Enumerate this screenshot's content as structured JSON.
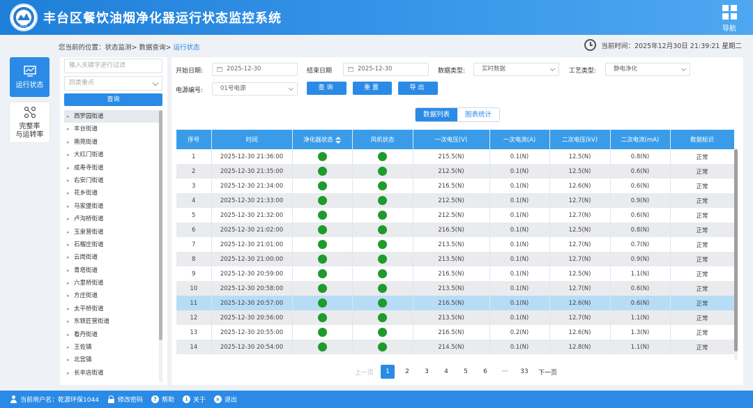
{
  "header": {
    "title": "丰台区餐饮油烟净化器运行状态监控系统",
    "logo_text": "MEE",
    "nav_label": "导航"
  },
  "breadcrumb": {
    "prefix": "您当前的位置：",
    "level1": "状态监测",
    "level2": "数据查询",
    "current": "运行状态"
  },
  "time": {
    "label": "当前时间：",
    "value": "2025年12月30日 21:39:21 星期二"
  },
  "side_nav": [
    {
      "label": "运行状态",
      "active": true
    },
    {
      "label1": "完整率",
      "label2": "与运转率",
      "active": false
    }
  ],
  "tree_panel": {
    "filter_placeholder": "输入关键字进行过滤",
    "select_placeholder": "四类重点",
    "query_label": "查询",
    "items": [
      "西罗园街道",
      "丰台街道",
      "南苑街道",
      "大红门街道",
      "成寿寺街道",
      "右安门街道",
      "花乡街道",
      "马家堡街道",
      "卢沟桥街道",
      "玉泉营街道",
      "石榴庄街道",
      "云岗街道",
      "青塔街道",
      "六里桥街道",
      "方庄街道",
      "太平桥街道",
      "东铁匠营街道",
      "看丹街道",
      "王佐镇",
      "北宫镇",
      "长辛店街道"
    ]
  },
  "filters": {
    "start_label": "开始日期:",
    "start_value": "2025-12-30",
    "end_label": "结束日期",
    "end_value": "2025-12-30",
    "data_type_label": "数据类型:",
    "data_type_value": "实时数据",
    "process_label": "工艺类型:",
    "process_value": "静电净化",
    "power_label": "电源编号:",
    "power_value": "01号电源",
    "query_btn": "查询",
    "reset_btn": "重置",
    "export_btn": "导出"
  },
  "tabs": {
    "list": "数据列表",
    "chart": "图表统计"
  },
  "table": {
    "headers": [
      "序号",
      "时间",
      "净化器状态",
      "风机状态",
      "一次电压(V)",
      "一次电流(A)",
      "二次电压(kV)",
      "二次电流(mA)",
      "数据标识"
    ],
    "rows": [
      [
        "1",
        "2025-12-30 21:36:00",
        "215.5(N)",
        "0.1(N)",
        "12.5(N)",
        "0.8(N)",
        "正常"
      ],
      [
        "2",
        "2025-12-30 21:35:00",
        "212.5(N)",
        "0.1(N)",
        "12.5(N)",
        "0.6(N)",
        "正常"
      ],
      [
        "3",
        "2025-12-30 21:34:00",
        "216.5(N)",
        "0.1(N)",
        "12.6(N)",
        "0.6(N)",
        "正常"
      ],
      [
        "4",
        "2025-12-30 21:33:00",
        "212.5(N)",
        "0.1(N)",
        "12.7(N)",
        "0.9(N)",
        "正常"
      ],
      [
        "5",
        "2025-12-30 21:32:00",
        "212.5(N)",
        "0.1(N)",
        "12.7(N)",
        "0.6(N)",
        "正常"
      ],
      [
        "6",
        "2025-12-30 21:02:00",
        "216.5(N)",
        "0.1(N)",
        "12.5(N)",
        "0.8(N)",
        "正常"
      ],
      [
        "7",
        "2025-12-30 21:01:00",
        "213.5(N)",
        "0.1(N)",
        "12.7(N)",
        "0.7(N)",
        "正常"
      ],
      [
        "8",
        "2025-12-30 21:00:00",
        "213.5(N)",
        "0.1(N)",
        "12.7(N)",
        "0.9(N)",
        "正常"
      ],
      [
        "9",
        "2025-12-30 20:59:00",
        "216.5(N)",
        "0.1(N)",
        "12.5(N)",
        "1.1(N)",
        "正常"
      ],
      [
        "10",
        "2025-12-30 20:58:00",
        "213.5(N)",
        "0.1(N)",
        "12.7(N)",
        "0.6(N)",
        "正常"
      ],
      [
        "11",
        "2025-12-30 20:57:00",
        "216.5(N)",
        "0.1(N)",
        "12.6(N)",
        "0.6(N)",
        "正常"
      ],
      [
        "12",
        "2025-12-30 20:56:00",
        "213.5(N)",
        "0.1(N)",
        "12.7(N)",
        "1.1(N)",
        "正常"
      ],
      [
        "13",
        "2025-12-30 20:55:00",
        "216.5(N)",
        "0.2(N)",
        "12.6(N)",
        "1.3(N)",
        "正常"
      ],
      [
        "14",
        "2025-12-30 20:54:00",
        "214.5(N)",
        "0.1(N)",
        "12.8(N)",
        "1.1(N)",
        "正常"
      ]
    ]
  },
  "pager": {
    "prev": "上一页",
    "pages": [
      "1",
      "2",
      "3",
      "4",
      "5",
      "6",
      "···",
      "33"
    ],
    "current": "1",
    "next": "下一页"
  },
  "footer": {
    "user_label": "当前用户名：",
    "user_name": "乾源环保1044",
    "change_pwd": "修改密码",
    "help": "帮助",
    "about": "关于",
    "logout": "退出"
  },
  "colors": {
    "primary": "#2a8ae6",
    "status_on": "#1f9a2d",
    "highlight_row": "#b7dcf5"
  }
}
